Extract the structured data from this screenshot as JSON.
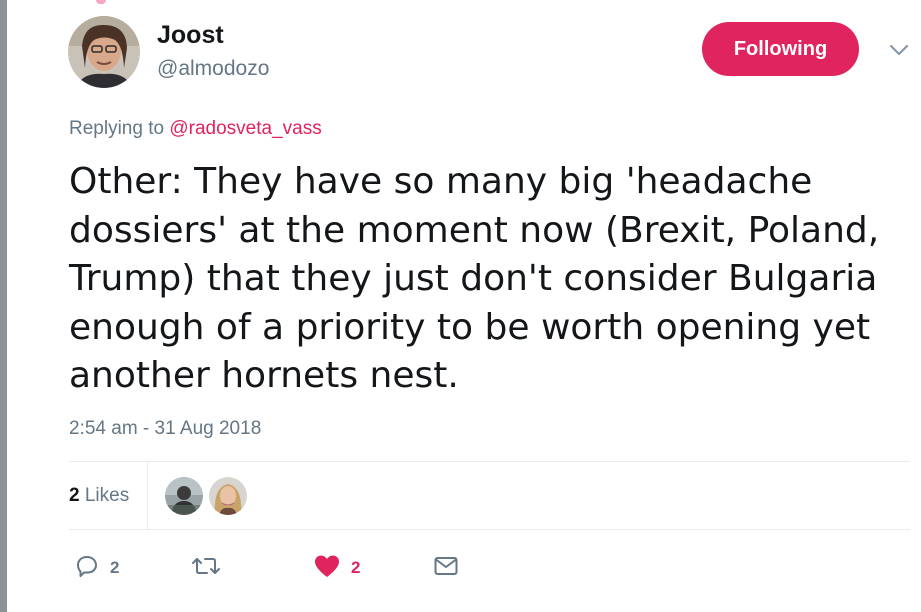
{
  "author": {
    "name": "Joost",
    "handle": "@almodozo"
  },
  "follow_button": {
    "label": "Following",
    "color": "#e0245e"
  },
  "reply_context": {
    "prefix": "Replying to ",
    "mention": "@radosveta_vass"
  },
  "tweet": {
    "lines": [
      "Other: They have so many big 'headache",
      "dossiers' at the moment now (Brexit, Poland,",
      "Trump) that they just don't consider Bulgaria",
      "enough of a priority to be worth opening yet",
      "another hornets nest."
    ],
    "timestamp": "2:54 am - 31 Aug 2018"
  },
  "stats": {
    "likes_count": "2",
    "likes_label": " Likes"
  },
  "actions": {
    "reply": {
      "icon": "reply-icon",
      "count": "2"
    },
    "retweet": {
      "icon": "retweet-icon",
      "count": ""
    },
    "like": {
      "icon": "heart-icon",
      "count": "2",
      "color": "#e0245e"
    },
    "message": {
      "icon": "envelope-icon",
      "count": ""
    }
  }
}
